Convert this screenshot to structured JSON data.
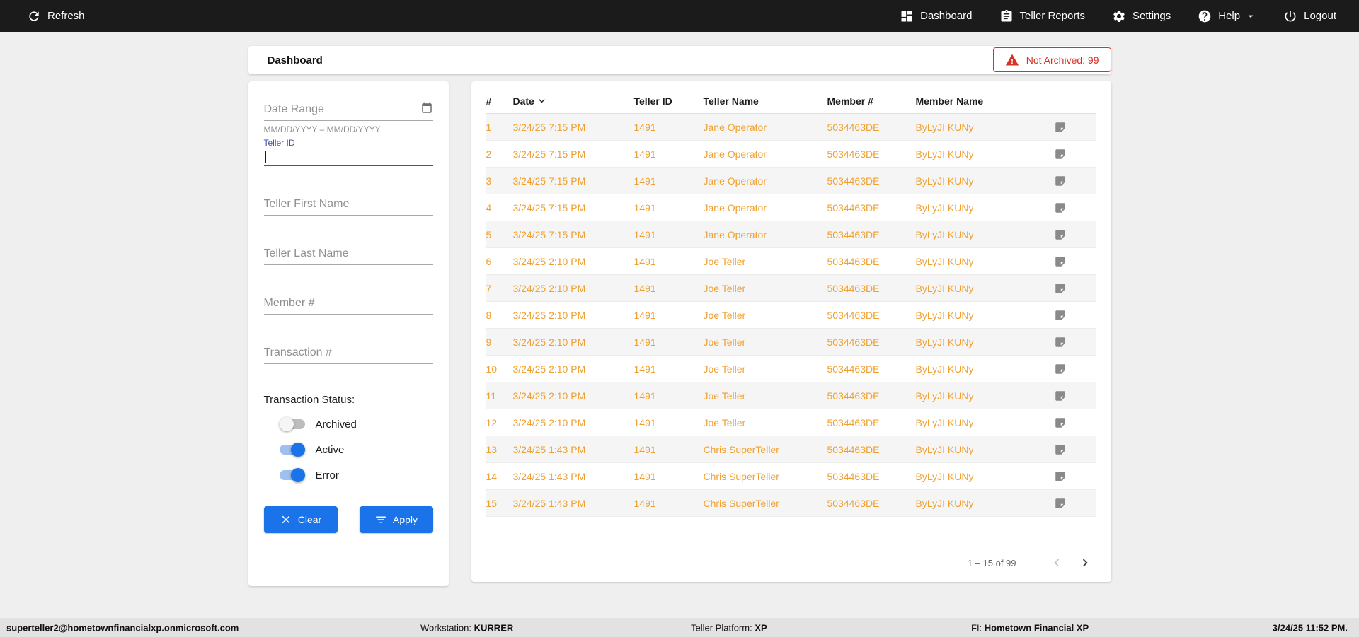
{
  "colors": {
    "topbar_bg": "#1b1b1b",
    "accent_blue": "#1a73e8",
    "focus_indigo": "#3f51b5",
    "row_orange": "#f0a030",
    "alert_red": "#d93025",
    "zebra_gray": "#f5f5f5"
  },
  "icons": {
    "refresh": "circular-arrow",
    "dashboard": "grid-squares",
    "teller_reports": "clipboard",
    "settings": "gear",
    "help": "question-circle",
    "help_caret": "chevron-down",
    "logout": "power",
    "calendar": "calendar",
    "warning": "triangle-exclamation",
    "clear": "x-mark",
    "apply": "filter-lines",
    "sort": "chevron-down",
    "note": "note-page",
    "prev_page": "chevron-left",
    "next_page": "chevron-right"
  },
  "topbar": {
    "refresh_label": "Refresh",
    "nav": [
      {
        "label": "Dashboard"
      },
      {
        "label": "Teller Reports"
      },
      {
        "label": "Settings"
      },
      {
        "label": "Help"
      },
      {
        "label": "Logout"
      }
    ]
  },
  "header": {
    "title": "Dashboard",
    "not_archived": "Not Archived: 99"
  },
  "filters": {
    "date_range_placeholder": "Date Range",
    "date_range_hint": "MM/DD/YYYY – MM/DD/YYYY",
    "teller_id_label": "Teller ID",
    "teller_id_value": "",
    "teller_first_name_placeholder": "Teller First Name",
    "teller_last_name_placeholder": "Teller Last Name",
    "member_number_placeholder": "Member #",
    "transaction_number_placeholder": "Transaction #",
    "status_label": "Transaction Status:",
    "toggles": [
      {
        "label": "Archived",
        "on": false
      },
      {
        "label": "Active",
        "on": true
      },
      {
        "label": "Error",
        "on": true
      }
    ],
    "clear_label": "Clear",
    "apply_label": "Apply"
  },
  "table": {
    "columns": [
      "#",
      "Date",
      "Teller ID",
      "Teller Name",
      "Member #",
      "Member Name"
    ],
    "rows": [
      {
        "num": "1",
        "date": "3/24/25 7:15 PM",
        "teller_id": "1491",
        "teller_name": "Jane Operator",
        "member_num": "5034463DE",
        "member_name": "ByLyJI KUNy"
      },
      {
        "num": "2",
        "date": "3/24/25 7:15 PM",
        "teller_id": "1491",
        "teller_name": "Jane Operator",
        "member_num": "5034463DE",
        "member_name": "ByLyJI KUNy"
      },
      {
        "num": "3",
        "date": "3/24/25 7:15 PM",
        "teller_id": "1491",
        "teller_name": "Jane Operator",
        "member_num": "5034463DE",
        "member_name": "ByLyJI KUNy"
      },
      {
        "num": "4",
        "date": "3/24/25 7:15 PM",
        "teller_id": "1491",
        "teller_name": "Jane Operator",
        "member_num": "5034463DE",
        "member_name": "ByLyJI KUNy"
      },
      {
        "num": "5",
        "date": "3/24/25 7:15 PM",
        "teller_id": "1491",
        "teller_name": "Jane Operator",
        "member_num": "5034463DE",
        "member_name": "ByLyJI KUNy"
      },
      {
        "num": "6",
        "date": "3/24/25 2:10 PM",
        "teller_id": "1491",
        "teller_name": "Joe Teller",
        "member_num": "5034463DE",
        "member_name": "ByLyJI KUNy"
      },
      {
        "num": "7",
        "date": "3/24/25 2:10 PM",
        "teller_id": "1491",
        "teller_name": "Joe Teller",
        "member_num": "5034463DE",
        "member_name": "ByLyJI KUNy"
      },
      {
        "num": "8",
        "date": "3/24/25 2:10 PM",
        "teller_id": "1491",
        "teller_name": "Joe Teller",
        "member_num": "5034463DE",
        "member_name": "ByLyJI KUNy"
      },
      {
        "num": "9",
        "date": "3/24/25 2:10 PM",
        "teller_id": "1491",
        "teller_name": "Joe Teller",
        "member_num": "5034463DE",
        "member_name": "ByLyJI KUNy"
      },
      {
        "num": "10",
        "date": "3/24/25 2:10 PM",
        "teller_id": "1491",
        "teller_name": "Joe Teller",
        "member_num": "5034463DE",
        "member_name": "ByLyJI KUNy"
      },
      {
        "num": "11",
        "date": "3/24/25 2:10 PM",
        "teller_id": "1491",
        "teller_name": "Joe Teller",
        "member_num": "5034463DE",
        "member_name": "ByLyJI KUNy"
      },
      {
        "num": "12",
        "date": "3/24/25 2:10 PM",
        "teller_id": "1491",
        "teller_name": "Joe Teller",
        "member_num": "5034463DE",
        "member_name": "ByLyJI KUNy"
      },
      {
        "num": "13",
        "date": "3/24/25 1:43 PM",
        "teller_id": "1491",
        "teller_name": "Chris SuperTeller",
        "member_num": "5034463DE",
        "member_name": "ByLyJI KUNy"
      },
      {
        "num": "14",
        "date": "3/24/25 1:43 PM",
        "teller_id": "1491",
        "teller_name": "Chris SuperTeller",
        "member_num": "5034463DE",
        "member_name": "ByLyJI KUNy"
      },
      {
        "num": "15",
        "date": "3/24/25 1:43 PM",
        "teller_id": "1491",
        "teller_name": "Chris SuperTeller",
        "member_num": "5034463DE",
        "member_name": "ByLyJI KUNy"
      }
    ],
    "pagination": "1 – 15 of 99"
  },
  "footer": {
    "user": "superteller2@hometownfinancialxp.onmicrosoft.com",
    "workstation_label": "Workstation:",
    "workstation_value": "KURRER",
    "platform_label": "Teller Platform:",
    "platform_value": "XP",
    "fi_label": "FI:",
    "fi_value": "Hometown Financial XP",
    "datetime": "3/24/25 11:52 PM."
  }
}
